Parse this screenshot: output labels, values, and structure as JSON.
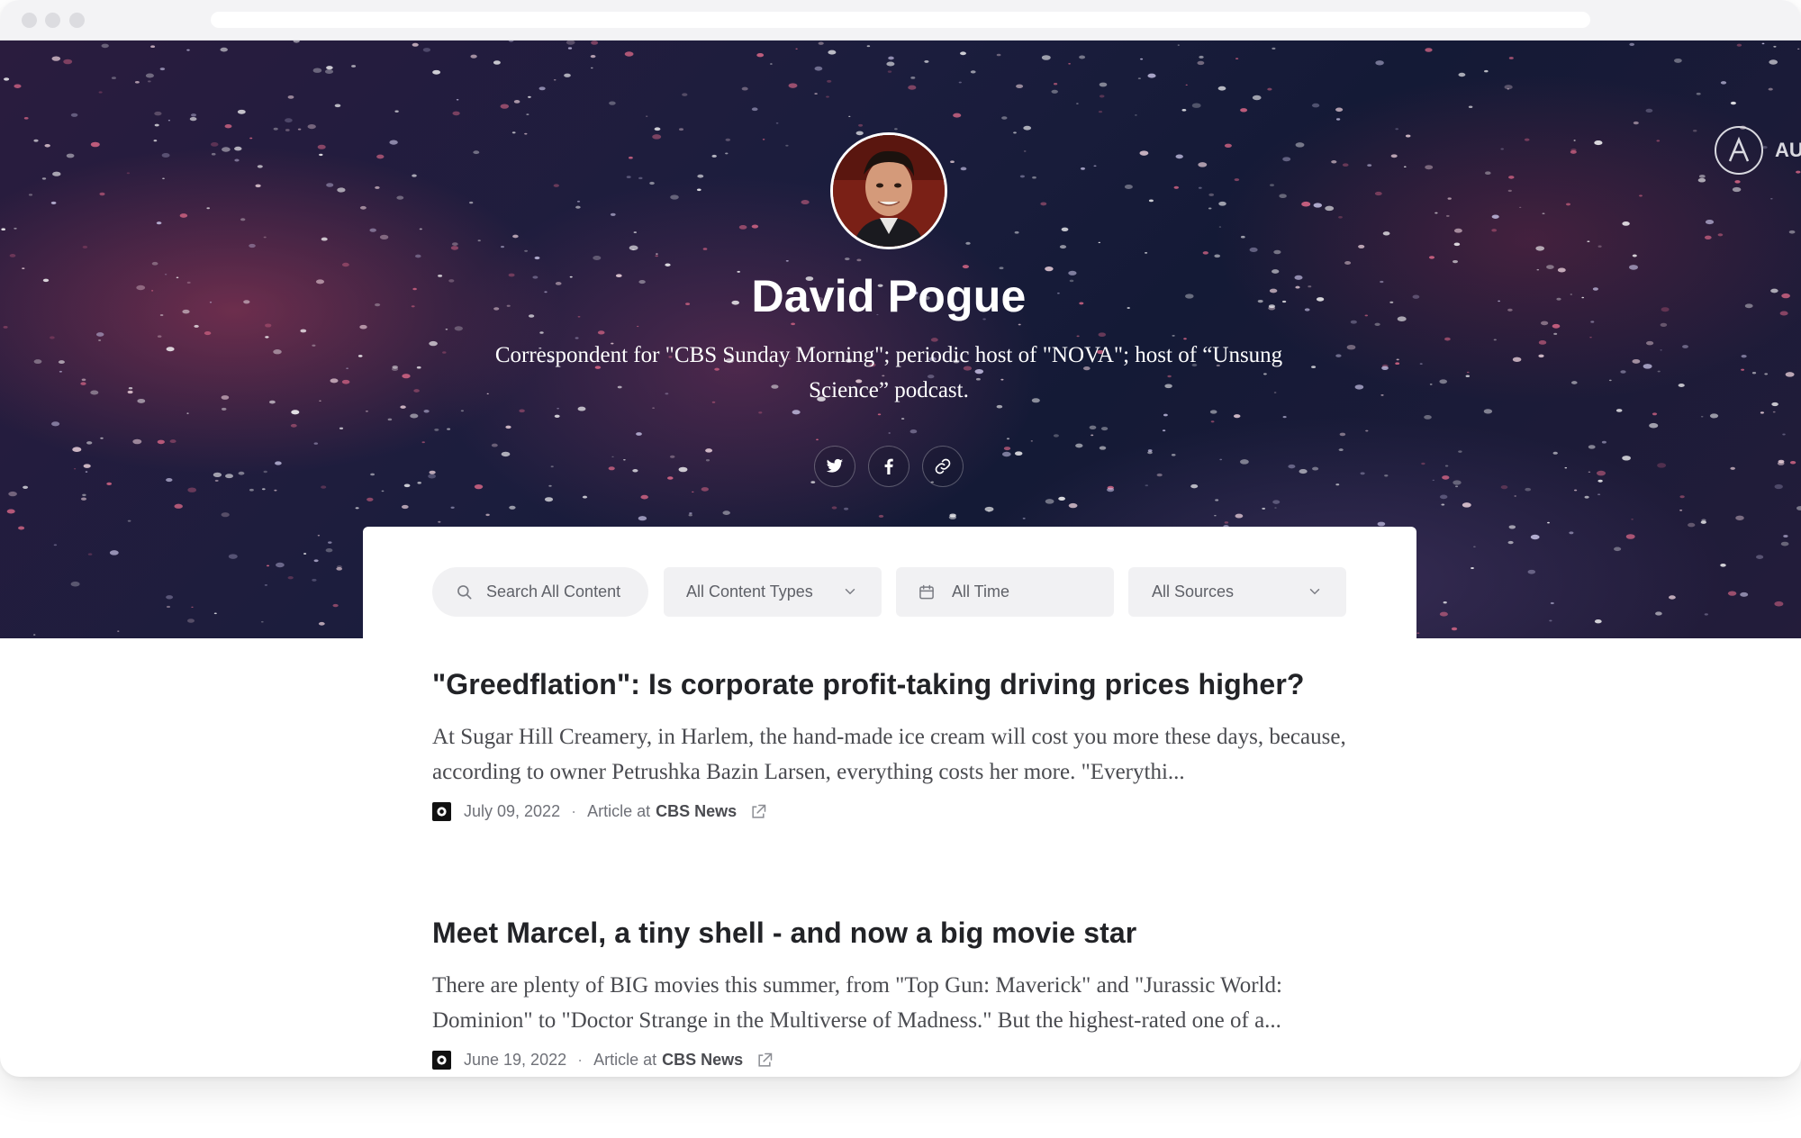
{
  "hero": {
    "brand_label": "AU",
    "profile": {
      "name": "David Pogue",
      "bio": "Correspondent for \"CBS Sunday Morning\"; periodic host of \"NOVA\"; host of “Unsung Science” podcast."
    },
    "social": [
      {
        "name": "twitter",
        "icon": "twitter-icon"
      },
      {
        "name": "facebook",
        "icon": "facebook-icon"
      },
      {
        "name": "link",
        "icon": "link-icon"
      }
    ]
  },
  "filters": {
    "search_placeholder": "Search All Content",
    "content_types": "All Content Types",
    "time": "All Time",
    "sources": "All Sources"
  },
  "articles": [
    {
      "title": "\"Greedflation\": Is corporate profit-taking driving prices higher?",
      "description": "At Sugar Hill Creamery, in Harlem, the hand-made ice cream will cost you more these days, because, according to owner Petrushka Bazin Larsen, everything costs her more. \"Everythi...",
      "date": "July 09, 2022",
      "type_prefix": "Article at",
      "source": "CBS News"
    },
    {
      "title": "Meet Marcel, a tiny shell - and now a big movie star",
      "description": "There are plenty of BIG movies this summer, from \"Top Gun: Maverick\" and \"Jurassic World: Dominion\" to \"Doctor Strange in the Multiverse of Madness.\" But the highest-rated one of a...",
      "date": "June 19, 2022",
      "type_prefix": "Article at",
      "source": "CBS News"
    }
  ],
  "colors": {
    "hero_dark": "#1b1d3d",
    "accent_red": "#a83c5a",
    "text_dark": "#222327",
    "filter_bg": "#f1f1f3"
  }
}
